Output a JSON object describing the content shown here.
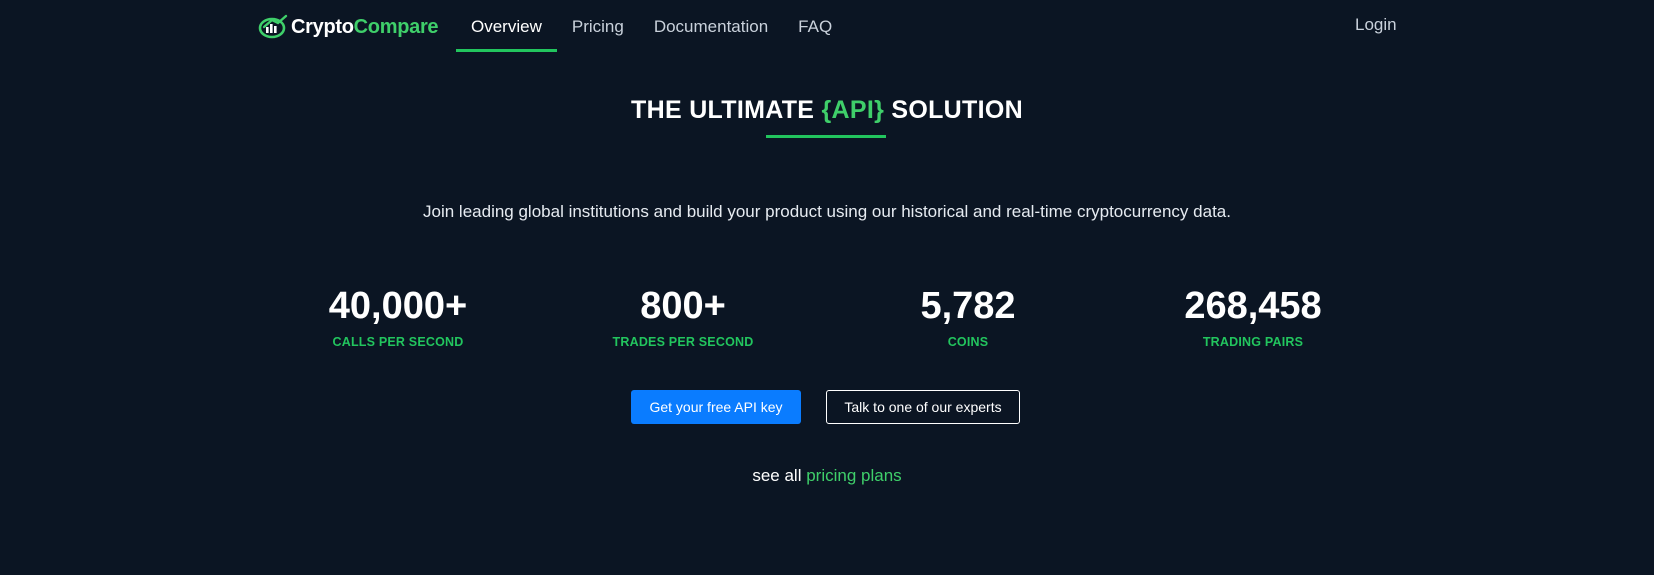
{
  "header": {
    "logo": {
      "part1": "Crypto",
      "part2": "Compare"
    },
    "nav": [
      {
        "label": "Overview",
        "active": true
      },
      {
        "label": "Pricing",
        "active": false
      },
      {
        "label": "Documentation",
        "active": false
      },
      {
        "label": "FAQ",
        "active": false
      }
    ],
    "login_label": "Login"
  },
  "hero": {
    "title_prefix": "THE ULTIMATE ",
    "title_highlight": "{API}",
    "title_suffix": " SOLUTION",
    "subtitle": "Join leading global institutions and build your product using our historical and real-time cryptocurrency data."
  },
  "stats": [
    {
      "value": "40,000+",
      "label": "CALLS PER SECOND"
    },
    {
      "value": "800+",
      "label": "TRADES PER SECOND"
    },
    {
      "value": "5,782",
      "label": "COINS"
    },
    {
      "value": "268,458",
      "label": "TRADING PAIRS"
    }
  ],
  "cta": {
    "primary_label": "Get your free API key",
    "secondary_label": "Talk to one of our experts"
  },
  "footer_link": {
    "prefix": "see all ",
    "link_label": "pricing plans"
  },
  "colors": {
    "background": "#0b1523",
    "accent_green": "#22c55e",
    "primary_blue": "#0a7cff"
  }
}
